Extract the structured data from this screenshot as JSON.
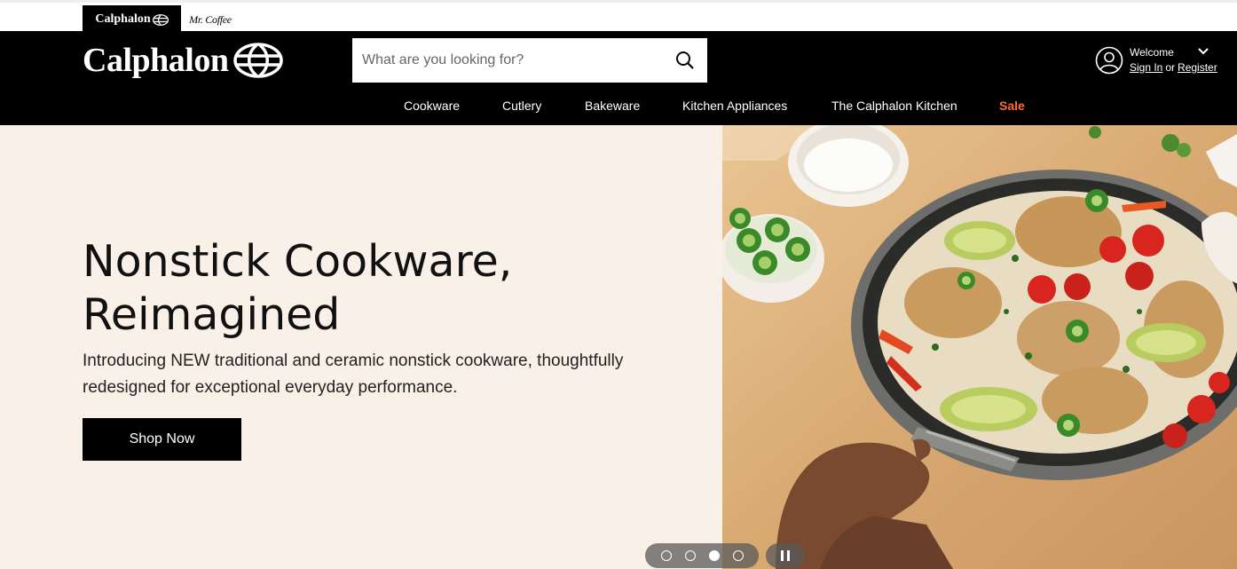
{
  "brand_strip": {
    "tabs": [
      {
        "label": "Calphalon",
        "active": true
      },
      {
        "label": "Mr. Coffee",
        "active": false
      }
    ]
  },
  "header": {
    "logo_text": "Calphalon",
    "search": {
      "placeholder": "What are you looking for?"
    },
    "account": {
      "welcome": "Welcome",
      "sign_in": "Sign In",
      "or": "or",
      "register": "Register"
    },
    "nav": [
      {
        "label": "Cookware"
      },
      {
        "label": "Cutlery"
      },
      {
        "label": "Bakeware"
      },
      {
        "label": "Kitchen Appliances"
      },
      {
        "label": "The Calphalon Kitchen"
      },
      {
        "label": "Sale"
      }
    ]
  },
  "hero": {
    "title_line1": "Nonstick Cookware,",
    "title_line2": "Reimagined",
    "subtitle_line1": "Introducing NEW traditional and ceramic nonstick cookware, thoughtfully",
    "subtitle_line2": "redesigned for exceptional everyday performance.",
    "cta": "Shop Now",
    "carousel": {
      "slide_count": 4,
      "active_index": 2
    }
  },
  "colors": {
    "header_bg": "#000000",
    "hero_bg": "#f9f0e8",
    "sale": "#ff6a3d",
    "wood": "#d9a972"
  }
}
